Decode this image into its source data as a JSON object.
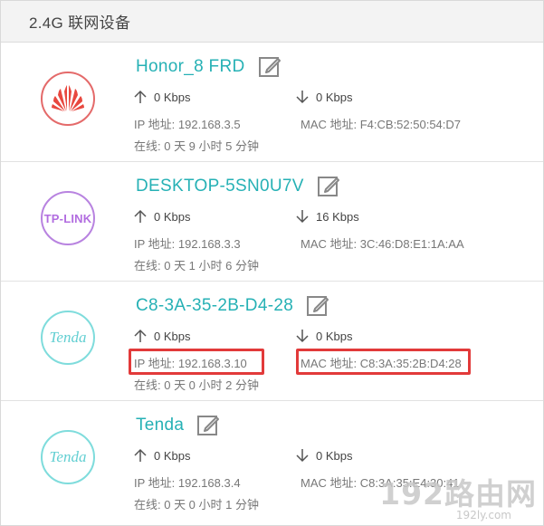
{
  "header": {
    "title": "2.4G 联网设备"
  },
  "devices": [
    {
      "brand": "huawei",
      "name": "Honor_8 FRD",
      "upload": "0 Kbps",
      "download": "0 Kbps",
      "ip": "IP 地址: 192.168.3.5",
      "mac": "MAC 地址: F4:CB:52:50:54:D7",
      "online": "在线: 0 天 9 小时 5 分钟"
    },
    {
      "brand": "tplink",
      "logo_text": "TP-LINK",
      "name": "DESKTOP-5SN0U7V",
      "upload": "0 Kbps",
      "download": "16 Kbps",
      "ip": "IP 地址: 192.168.3.3",
      "mac": "MAC 地址: 3C:46:D8:E1:1A:AA",
      "online": "在线: 0 天 1 小时 6 分钟"
    },
    {
      "brand": "tenda",
      "logo_text": "Tenda",
      "name": "C8-3A-35-2B-D4-28",
      "upload": "0 Kbps",
      "download": "0 Kbps",
      "ip": "IP 地址: 192.168.3.10",
      "mac": "MAC 地址: C8:3A:35:2B:D4:28",
      "online": "在线: 0 天 0 小时 2 分钟"
    },
    {
      "brand": "tenda",
      "logo_text": "Tenda",
      "name": "Tenda",
      "upload": "0 Kbps",
      "download": "0 Kbps",
      "ip": "IP 地址: 192.168.3.4",
      "mac": "MAC 地址: C8:3A:35:E4:30:41",
      "online": "在线: 0 天 0 小时 1 分钟"
    }
  ],
  "watermark": {
    "main": "192路由网",
    "sub": "192ly.com"
  },
  "colors": {
    "device_name": "#26b1b5",
    "highlight": "#e23a3a",
    "huawei": "#e46a6a",
    "tplink": "#b883e0",
    "tenda": "#7fdcdc"
  },
  "icons": {
    "edit": "edit-icon",
    "upload": "arrow-up-icon",
    "download": "arrow-down-icon"
  }
}
